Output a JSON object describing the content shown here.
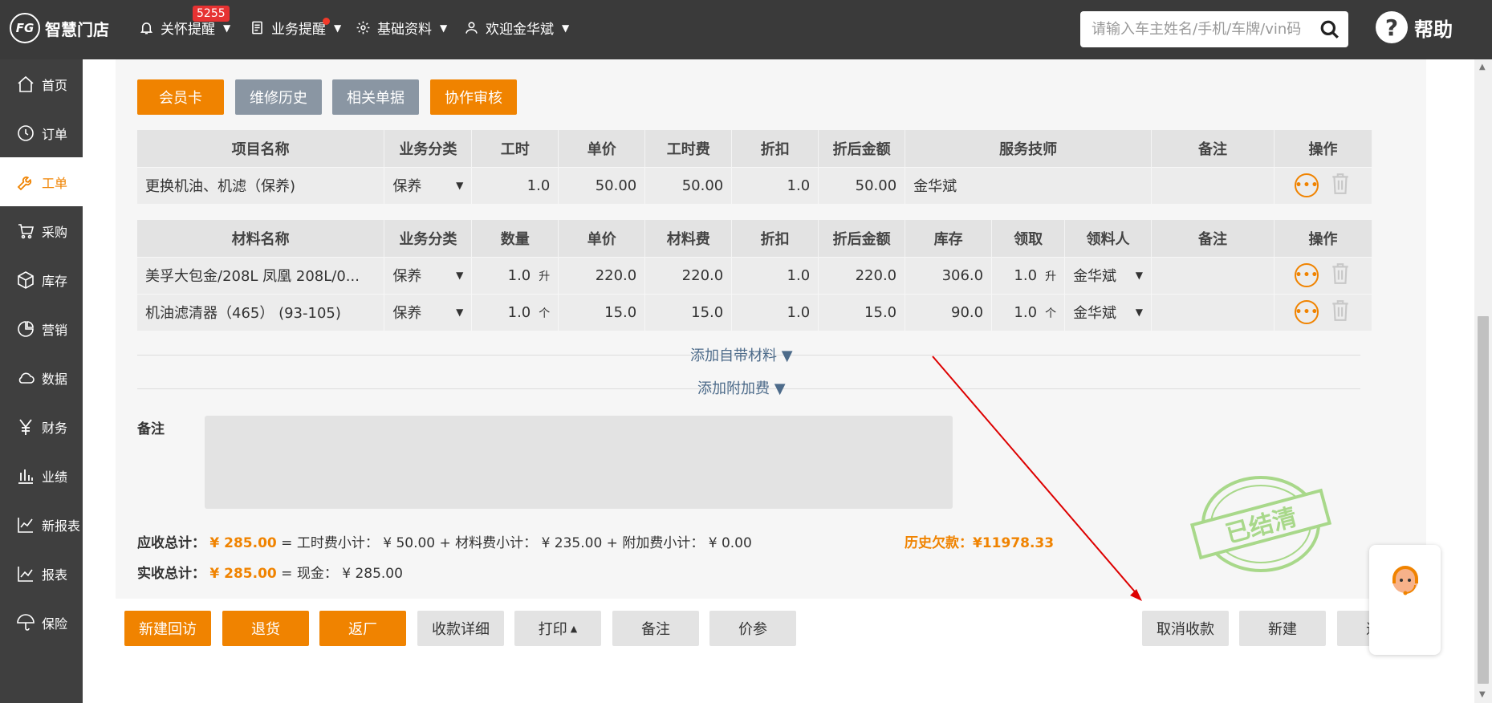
{
  "topbar": {
    "logo_mark": "FG",
    "logo_text": "智慧门店",
    "nav": [
      {
        "label": "关怀提醒",
        "icon": "bell-icon"
      },
      {
        "label": "业务提醒",
        "icon": "document-icon"
      },
      {
        "label": "基础资料",
        "icon": "gear-icon"
      },
      {
        "label": "欢迎金华斌",
        "icon": "user-icon"
      }
    ],
    "care_badge": "5255",
    "search_placeholder": "请输入车主姓名/手机/车牌/vin码",
    "help_label": "帮助"
  },
  "sidebar": {
    "items": [
      {
        "label": "首页",
        "icon": "home-icon"
      },
      {
        "label": "订单",
        "icon": "history-icon"
      },
      {
        "label": "工单",
        "icon": "wrench-icon"
      },
      {
        "label": "采购",
        "icon": "cart-icon"
      },
      {
        "label": "库存",
        "icon": "box-icon"
      },
      {
        "label": "营销",
        "icon": "pie-icon"
      },
      {
        "label": "数据",
        "icon": "cloud-icon"
      },
      {
        "label": "财务",
        "icon": "yen-icon"
      },
      {
        "label": "业绩",
        "icon": "bar-chart-icon"
      },
      {
        "label": "新报表",
        "icon": "line-chart-icon"
      },
      {
        "label": "报表",
        "icon": "trend-icon"
      },
      {
        "label": "保险",
        "icon": "umbrella-icon"
      }
    ],
    "active_index": 2
  },
  "tabs": {
    "member_card": "会员卡",
    "repair_history": "维修历史",
    "related_docs": "相关单据",
    "co_review": "协作审核"
  },
  "service_table": {
    "headers": [
      "项目名称",
      "业务分类",
      "工时",
      "单价",
      "工时费",
      "折扣",
      "折后金额",
      "服务技师",
      "备注",
      "操作"
    ],
    "rows": [
      {
        "name": "更换机油、机滤（保养)",
        "category": "保养",
        "hours": "1.0",
        "price": "50.00",
        "fee": "50.00",
        "discount": "1.0",
        "amount": "50.00",
        "technician": "金华斌",
        "note": ""
      }
    ]
  },
  "material_table": {
    "headers": [
      "材料名称",
      "业务分类",
      "数量",
      "单价",
      "材料费",
      "折扣",
      "折后金额",
      "库存",
      "领取",
      "领料人",
      "备注",
      "操作"
    ],
    "rows": [
      {
        "name": "美孚大包金/208L 凤凰 208L/0...",
        "category": "保养",
        "qty": "1.0",
        "qty_unit": "升",
        "price": "220.0",
        "fee": "220.0",
        "discount": "1.0",
        "amount": "220.0",
        "stock": "306.0",
        "taken": "1.0",
        "taken_unit": "升",
        "receiver": "金华斌",
        "note": ""
      },
      {
        "name": "机油滤清器（465） (93-105)",
        "category": "保养",
        "qty": "1.0",
        "qty_unit": "个",
        "price": "15.0",
        "fee": "15.0",
        "discount": "1.0",
        "amount": "15.0",
        "stock": "90.0",
        "taken": "1.0",
        "taken_unit": "个",
        "receiver": "金华斌",
        "note": ""
      }
    ]
  },
  "add_own_material": "添加自带材料 ▼",
  "add_surcharge": "添加附加费 ▼",
  "remark_label": "备注",
  "totals": {
    "receivable_label": "应收总计：",
    "receivable_amount": "¥ 285.00",
    "receivable_detail": "= 工时费小计：  ¥ 50.00 + 材料费小计：  ¥ 235.00 + 附加费小计：  ¥ 0.00",
    "received_label": "实收总计：",
    "received_amount": "¥ 285.00",
    "received_detail": "= 现金：  ¥ 285.00",
    "history_debt": "历史欠款：¥11978.33"
  },
  "stamp_text": "已结清",
  "footer_buttons": {
    "new_callback": "新建回访",
    "return_goods": "退货",
    "return_factory": "返厂",
    "payment_detail": "收款详细",
    "print": "打印",
    "remark": "备注",
    "price_ref": "价参",
    "cancel_payment": "取消收款",
    "new": "新建",
    "exit": "退出"
  },
  "colors": {
    "accent": "#f08300",
    "topbar": "#3a3a3a",
    "sidebar": "#3f3f3f",
    "annotation_arrow": "#dd0000"
  }
}
